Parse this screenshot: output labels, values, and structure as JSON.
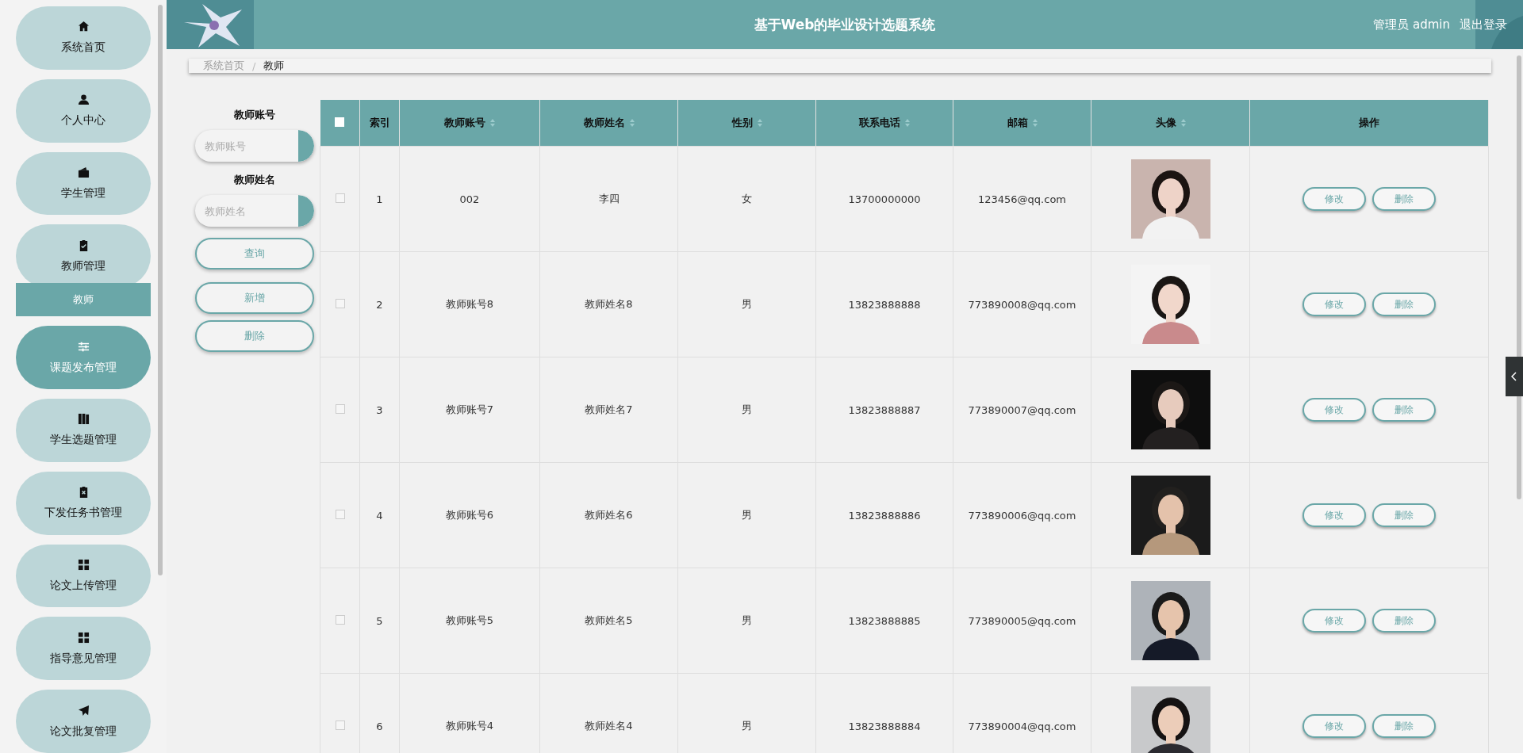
{
  "sidebar": {
    "items": [
      {
        "label": "系统首页",
        "selected": false
      },
      {
        "label": "个人中心",
        "selected": false
      },
      {
        "label": "学生管理",
        "selected": false
      },
      {
        "label": "教师管理",
        "selected": false,
        "expanded": true,
        "children": [
          {
            "label": "教师"
          }
        ]
      },
      {
        "label": "课题发布管理",
        "selected": true
      },
      {
        "label": "学生选题管理",
        "selected": false
      },
      {
        "label": "下发任务书管理",
        "selected": false
      },
      {
        "label": "论文上传管理",
        "selected": false
      },
      {
        "label": "指导意见管理",
        "selected": false
      },
      {
        "label": "论文批复管理",
        "selected": false
      }
    ]
  },
  "header": {
    "title": "基于Web的毕业设计选题系统",
    "user": "管理员 admin",
    "logout": "退出登录"
  },
  "breadcrumb": [
    {
      "label": "系统首页",
      "selected": false
    },
    {
      "label": "教师",
      "selected": true
    }
  ],
  "breadcrumb_separator": "/",
  "search": {
    "fields": [
      {
        "label": "教师账号",
        "placeholder": "教师账号"
      },
      {
        "label": "教师姓名",
        "placeholder": "教师姓名"
      }
    ],
    "query_button": "查询",
    "add_button": "新增",
    "delete_button": "删除"
  },
  "table": {
    "all_checked": false,
    "columns": [
      {
        "label": "索引",
        "sortable": false
      },
      {
        "label": "教师账号",
        "sortable": true
      },
      {
        "label": "教师姓名",
        "sortable": true
      },
      {
        "label": "性别",
        "sortable": true
      },
      {
        "label": "联系电话",
        "sortable": true
      },
      {
        "label": "邮箱",
        "sortable": true
      },
      {
        "label": "头像",
        "sortable": true
      },
      {
        "label": "操作",
        "sortable": false
      }
    ],
    "rows": [
      {
        "index": "1",
        "account": "002",
        "name": "李四",
        "gender": "女",
        "phone": "13700000000",
        "email": "123456@qq.com",
        "actions": [
          "修改",
          "删除"
        ],
        "checked": false
      },
      {
        "index": "2",
        "account": "教师账号8",
        "name": "教师姓名8",
        "gender": "男",
        "phone": "13823888888",
        "email": "773890008@qq.com",
        "actions": [
          "修改",
          "删除"
        ],
        "checked": false
      },
      {
        "index": "3",
        "account": "教师账号7",
        "name": "教师姓名7",
        "gender": "男",
        "phone": "13823888887",
        "email": "773890007@qq.com",
        "actions": [
          "修改",
          "删除"
        ],
        "checked": false
      },
      {
        "index": "4",
        "account": "教师账号6",
        "name": "教师姓名6",
        "gender": "男",
        "phone": "13823888886",
        "email": "773890006@qq.com",
        "actions": [
          "修改",
          "删除"
        ],
        "checked": false
      },
      {
        "index": "5",
        "account": "教师账号5",
        "name": "教师姓名5",
        "gender": "男",
        "phone": "13823888885",
        "email": "773890005@qq.com",
        "actions": [
          "修改",
          "删除"
        ],
        "checked": false
      },
      {
        "index": "6",
        "account": "教师账号4",
        "name": "教师姓名4",
        "gender": "男",
        "phone": "13823888884",
        "email": "773890004@qq.com",
        "actions": [
          "修改",
          "删除"
        ],
        "checked": false
      }
    ]
  }
}
